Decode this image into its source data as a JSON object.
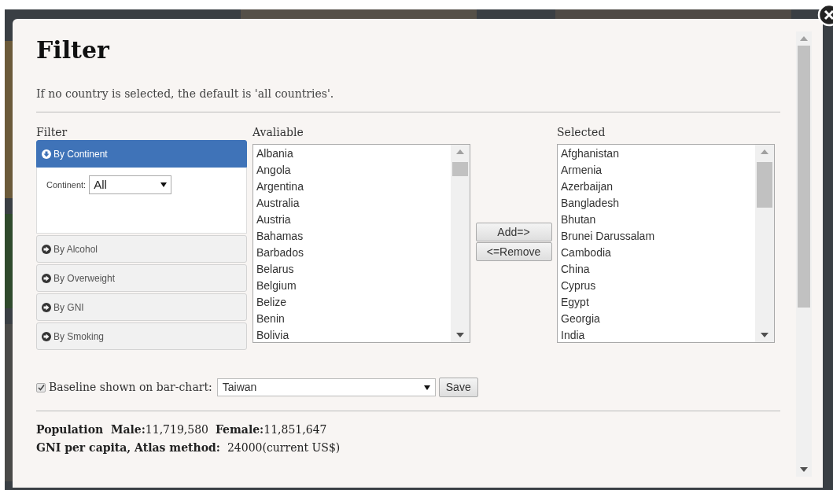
{
  "title": "Filter",
  "note": "If no country is selected, the default is 'all countries'.",
  "filter": {
    "heading": "Filter",
    "sections": [
      {
        "label": "By Continent",
        "expanded": true,
        "field_label": "Continent:",
        "field_value": "All"
      },
      {
        "label": "By Alcohol",
        "expanded": false
      },
      {
        "label": "By Overweight",
        "expanded": false
      },
      {
        "label": "By GNI",
        "expanded": false
      },
      {
        "label": "By Smoking",
        "expanded": false
      }
    ]
  },
  "available": {
    "heading": "Avaliable",
    "items": [
      "Albania",
      "Angola",
      "Argentina",
      "Australia",
      "Austria",
      "Bahamas",
      "Barbados",
      "Belarus",
      "Belgium",
      "Belize",
      "Benin",
      "Bolivia"
    ]
  },
  "transfer_buttons": [
    "Add=>",
    "<=Remove"
  ],
  "selected": {
    "heading": "Selected",
    "items": [
      "Afghanistan",
      "Armenia",
      "Azerbaijan",
      "Bangladesh",
      "Bhutan",
      "Brunei Darussalam",
      "Cambodia",
      "China",
      "Cyprus",
      "Egypt",
      "Georgia",
      "India"
    ]
  },
  "baseline": {
    "checked": true,
    "label": "Baseline shown on bar-chart:",
    "value": "Taiwan",
    "button": "Save"
  },
  "info": [
    "**Population  Male:**11,719,580  **Female:**11,851,647",
    "**GNI per capita, Atlas method:**  24000(current US$)"
  ]
}
